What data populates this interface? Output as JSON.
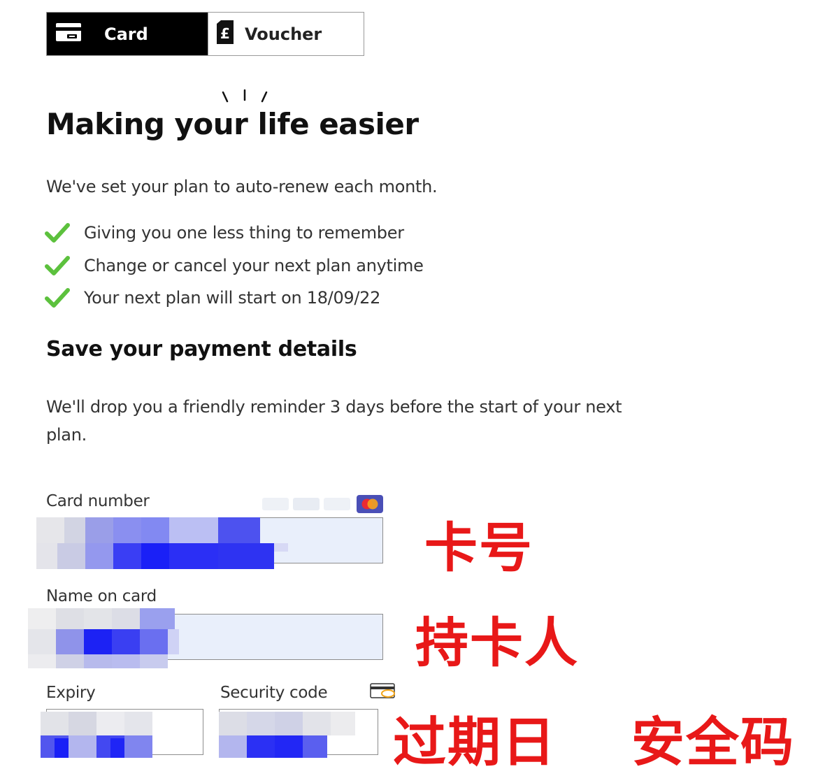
{
  "tabs": [
    {
      "label": "Card",
      "icon": "credit-card-icon",
      "active": true
    },
    {
      "label": "Voucher",
      "icon": "pound-voucher-icon",
      "active": false
    }
  ],
  "heading": "Making your life easier",
  "intro": "We've set your plan to auto-renew each month.",
  "benefits": [
    "Giving you one less thing to remember",
    "Change or cancel your next plan anytime",
    "Your next plan will start on 18/09/22"
  ],
  "payment": {
    "heading": "Save your payment details",
    "reminder": "We'll drop you a friendly reminder 3 days before the start of your next plan."
  },
  "form": {
    "card_number_label": "Card number",
    "name_label": "Name on card",
    "expiry_label": "Expiry",
    "security_label": "Security code"
  },
  "annotations": {
    "card_number": "卡号",
    "name": "持卡人",
    "expiry": "过期日",
    "security": "安全码"
  },
  "colors": {
    "accent_dark": "#000000",
    "check_green": "#5cc13d",
    "annotation_red": "#e81818",
    "field_fill": "#e9effb"
  }
}
